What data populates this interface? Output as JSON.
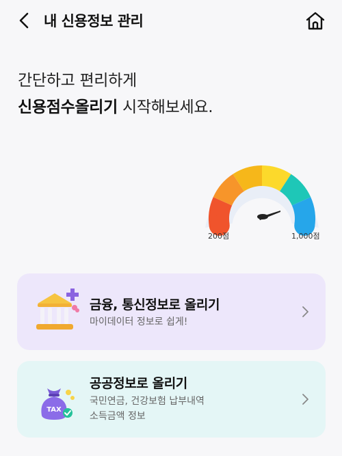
{
  "header": {
    "title": "내 신용정보 관리",
    "back_icon": "chevron-left-icon",
    "home_icon": "home-icon"
  },
  "hero": {
    "line1": "간단하고 편리하게",
    "line2_bold": "신용점수올리기",
    "line2_rest": " 시작해보세요."
  },
  "gauge": {
    "min_label": "200점",
    "max_label": "1,000점",
    "colors": [
      "#f0542c",
      "#f7952a",
      "#f6b71a",
      "#fcd92b",
      "#1ec7b7",
      "#26a6ea"
    ]
  },
  "cards": [
    {
      "title": "금융, 통신정보로 올리기",
      "subtitle": "마이데이터 정보로 쉽게!",
      "icon": "bank-icon",
      "bg": "#ede7fb"
    },
    {
      "title": "공공정보로 올리기",
      "subtitle_line1": "국민연금, 건강보험 납부내역",
      "subtitle_line2": "소득금액 정보",
      "icon": "tax-bag-icon",
      "icon_text": "TAX",
      "bg": "#e4f6f6"
    }
  ]
}
